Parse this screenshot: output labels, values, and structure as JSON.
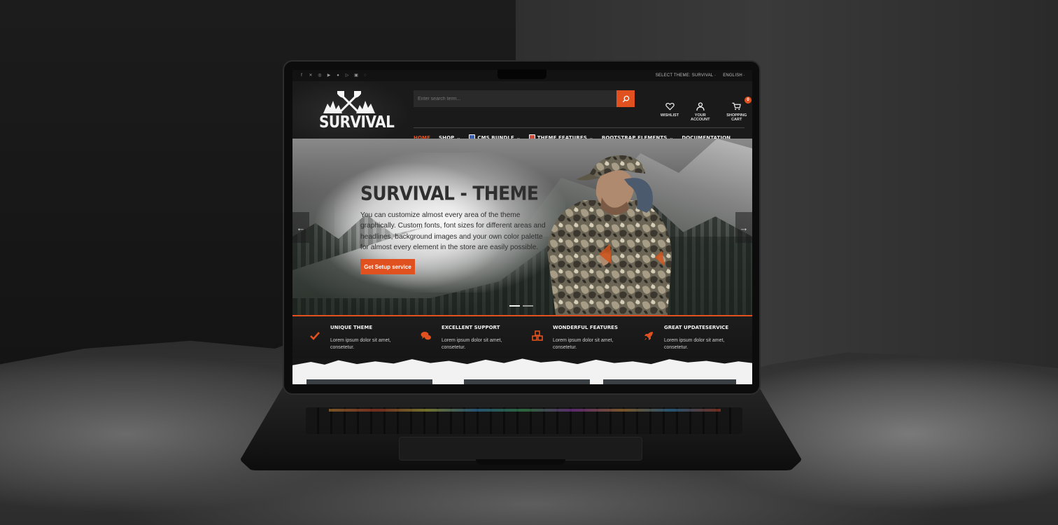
{
  "topbar": {
    "social_icons": [
      "facebook-icon",
      "x-icon",
      "instagram-icon",
      "youtube-icon",
      "apple-icon",
      "google-play-icon",
      "twitch-icon",
      "whatsapp-icon"
    ],
    "select_theme": "SELECT THEME: SURVIVAL ·",
    "language": "ENGLISH ·"
  },
  "brand": {
    "name": "SURVIVAL"
  },
  "search": {
    "placeholder": "Enter search term..."
  },
  "header_icons": {
    "wishlist": "WISHLIST",
    "account": "YOUR ACCOUNT",
    "cart": "SHOPPING CART",
    "cart_count": "0"
  },
  "nav": {
    "items": [
      {
        "label": "HOME"
      },
      {
        "label": "SHOP"
      },
      {
        "label": "CMS BUNDLE"
      },
      {
        "label": "THEME FEATURES"
      },
      {
        "label": "BOOTSTRAP ELEMENTS"
      },
      {
        "label": "DOCUMENTATION"
      }
    ]
  },
  "hero": {
    "title": "SURVIVAL - THEME",
    "text": "You can customize almost every area of the theme graphically. Custom fonts, font sizes for different areas and headlines, background images and your own color palette for almost every element in the store are easily possible.",
    "button": "Get Setup service",
    "prev_arrow": "←",
    "next_arrow": "→",
    "active_slide": 1,
    "slide_count": 2
  },
  "features": [
    {
      "title": "UNIQUE THEME",
      "text": "Lorem ipsum dolor sit amet, consetetur."
    },
    {
      "title": "EXCELLENT SUPPORT",
      "text": "Lorem ipsum dolor sit amet, consetetur."
    },
    {
      "title": "WONDERFUL FEATURES",
      "text": "Lorem ipsum dolor sit amet, consetetur."
    },
    {
      "title": "GREAT UPDATESERVICE",
      "text": "Lorem ipsum dolor sit amet, consetetur."
    }
  ],
  "colors": {
    "accent": "#e1511f",
    "dark_bg": "#171717",
    "text_light": "#f3f3f3"
  }
}
